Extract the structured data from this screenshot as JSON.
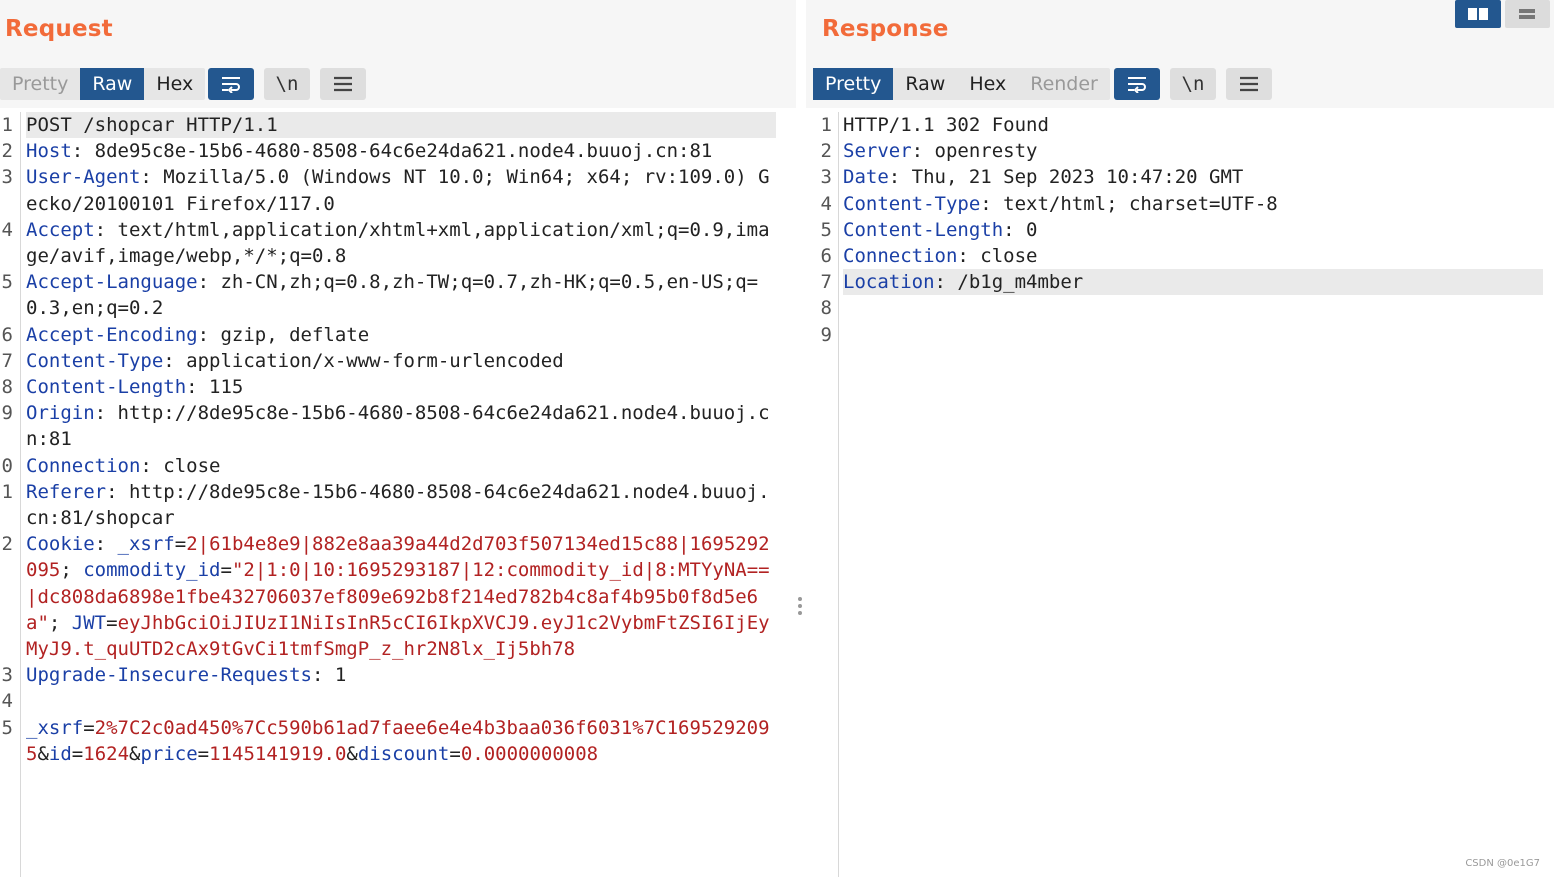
{
  "request": {
    "title": "Request",
    "tabs": [
      "Pretty",
      "Raw",
      "Hex"
    ],
    "active_tab": "Raw",
    "tools": {
      "wrap_icon": "wrap-lines-icon",
      "newline_label": "\\n",
      "menu_icon": "hamburger-menu-icon"
    },
    "lines": [
      {
        "n": "1",
        "parts": [
          [
            "s",
            "POST /shopcar HTTP/1.1"
          ]
        ],
        "highlight": true
      },
      {
        "n": "2",
        "parts": [
          [
            "k",
            "Host"
          ],
          [
            "v",
            ": 8de95c8e-15b6-4680-8508-64c6e24da621.node4.buuoj.cn:81"
          ]
        ]
      },
      {
        "n": "3",
        "parts": [
          [
            "k",
            "User-Agent"
          ],
          [
            "v",
            ": Mozilla/5.0 (Windows NT 10.0; Win64; x64; rv:109.0) Gecko/20100101 Firefox/117.0"
          ]
        ]
      },
      {
        "n": "4",
        "parts": [
          [
            "k",
            "Accept"
          ],
          [
            "v",
            ": text/html,application/xhtml+xml,application/xml;q=0.9,image/avif,image/webp,*/*;q=0.8"
          ]
        ]
      },
      {
        "n": "5",
        "parts": [
          [
            "k",
            "Accept-Language"
          ],
          [
            "v",
            ": zh-CN,zh;q=0.8,zh-TW;q=0.7,zh-HK;q=0.5,en-US;q=0.3,en;q=0.2"
          ]
        ]
      },
      {
        "n": "6",
        "parts": [
          [
            "k",
            "Accept-Encoding"
          ],
          [
            "v",
            ": gzip, deflate"
          ]
        ]
      },
      {
        "n": "7",
        "parts": [
          [
            "k",
            "Content-Type"
          ],
          [
            "v",
            ": application/x-www-form-urlencoded"
          ]
        ]
      },
      {
        "n": "8",
        "parts": [
          [
            "k",
            "Content-Length"
          ],
          [
            "v",
            ": 115"
          ]
        ]
      },
      {
        "n": "9",
        "parts": [
          [
            "k",
            "Origin"
          ],
          [
            "v",
            ": http://8de95c8e-15b6-4680-8508-64c6e24da621.node4.buuoj.cn:81"
          ]
        ]
      },
      {
        "n": "0",
        "parts": [
          [
            "k",
            "Connection"
          ],
          [
            "v",
            ": close"
          ]
        ]
      },
      {
        "n": "1",
        "parts": [
          [
            "k",
            "Referer"
          ],
          [
            "v",
            ": http://8de95c8e-15b6-4680-8508-64c6e24da621.node4.buuoj.cn:81/shopcar"
          ]
        ]
      },
      {
        "n": "2",
        "parts": [
          [
            "k",
            "Cookie"
          ],
          [
            "v",
            ": "
          ],
          [
            "k",
            "_xsrf"
          ],
          [
            "v",
            "="
          ],
          [
            "r",
            "2|61b4e8e9|882e8aa39a44d2d703f507134ed15c88|1695292095"
          ],
          [
            "v",
            "; "
          ],
          [
            "k",
            "commodity_id"
          ],
          [
            "v",
            "="
          ],
          [
            "r",
            "\"2|1:0|10:1695293187|12:commodity_id|8:MTYyNA==|dc808da6898e1fbe432706037ef809e692b8f214ed782b4c8af4b95b0f8d5e6a\""
          ],
          [
            "v",
            "; "
          ],
          [
            "k",
            "JWT"
          ],
          [
            "v",
            "="
          ],
          [
            "r",
            "eyJhbGciOiJIUzI1NiIsInR5cCI6IkpXVCJ9.eyJ1c2VybmFtZSI6IjEyMyJ9.t_quUTD2cAx9tGvCi1tmfSmgP_z_hr2N8lx_Ij5bh78"
          ]
        ]
      },
      {
        "n": "3",
        "parts": [
          [
            "k",
            "Upgrade-Insecure-Requests"
          ],
          [
            "v",
            ": 1"
          ]
        ]
      },
      {
        "n": "4",
        "parts": [
          [
            "v",
            ""
          ]
        ]
      },
      {
        "n": "5",
        "parts": [
          [
            "k",
            "_xsrf"
          ],
          [
            "v",
            "="
          ],
          [
            "r",
            "2%7C2c0ad450%7Cc590b61ad7faee6e4e4b3baa036f6031%7C1695292095"
          ],
          [
            "v",
            "&"
          ],
          [
            "k",
            "id"
          ],
          [
            "v",
            "="
          ],
          [
            "r",
            "1624"
          ],
          [
            "v",
            "&"
          ],
          [
            "k",
            "price"
          ],
          [
            "v",
            "="
          ],
          [
            "r",
            "1145141919.0"
          ],
          [
            "v",
            "&"
          ],
          [
            "k",
            "discount"
          ],
          [
            "v",
            "="
          ],
          [
            "r",
            "0.0000000008"
          ]
        ]
      }
    ]
  },
  "response": {
    "title": "Response",
    "tabs": [
      "Pretty",
      "Raw",
      "Hex",
      "Render"
    ],
    "active_tab": "Pretty",
    "disabled_tab": "Render",
    "tools": {
      "wrap_icon": "wrap-lines-icon",
      "newline_label": "\\n",
      "menu_icon": "hamburger-menu-icon"
    },
    "lines": [
      {
        "n": "1",
        "parts": [
          [
            "s",
            "HTTP/1.1 302 Found"
          ]
        ]
      },
      {
        "n": "2",
        "parts": [
          [
            "k",
            "Server"
          ],
          [
            "v",
            ": openresty"
          ]
        ]
      },
      {
        "n": "3",
        "parts": [
          [
            "k",
            "Date"
          ],
          [
            "v",
            ": Thu, 21 Sep 2023 10:47:20 GMT"
          ]
        ]
      },
      {
        "n": "4",
        "parts": [
          [
            "k",
            "Content-Type"
          ],
          [
            "v",
            ": text/html; charset=UTF-8"
          ]
        ]
      },
      {
        "n": "5",
        "parts": [
          [
            "k",
            "Content-Length"
          ],
          [
            "v",
            ": 0"
          ]
        ]
      },
      {
        "n": "6",
        "parts": [
          [
            "k",
            "Connection"
          ],
          [
            "v",
            ": close"
          ]
        ]
      },
      {
        "n": "7",
        "parts": [
          [
            "k",
            "Location"
          ],
          [
            "v",
            ": /b1g_m4mber"
          ]
        ],
        "highlight": true
      },
      {
        "n": "8",
        "parts": [
          [
            "v",
            ""
          ]
        ]
      },
      {
        "n": "9",
        "parts": [
          [
            "v",
            ""
          ]
        ]
      }
    ]
  },
  "view_toggle": {
    "split_icon": "split-view-icon",
    "stacked_icon": "stacked-view-icon"
  },
  "watermark": "CSDN @0e1G7",
  "colors": {
    "accent": "#23578f",
    "title": "#f26b3a",
    "header_key": "#1a3fa6",
    "value_red": "#b22222"
  }
}
